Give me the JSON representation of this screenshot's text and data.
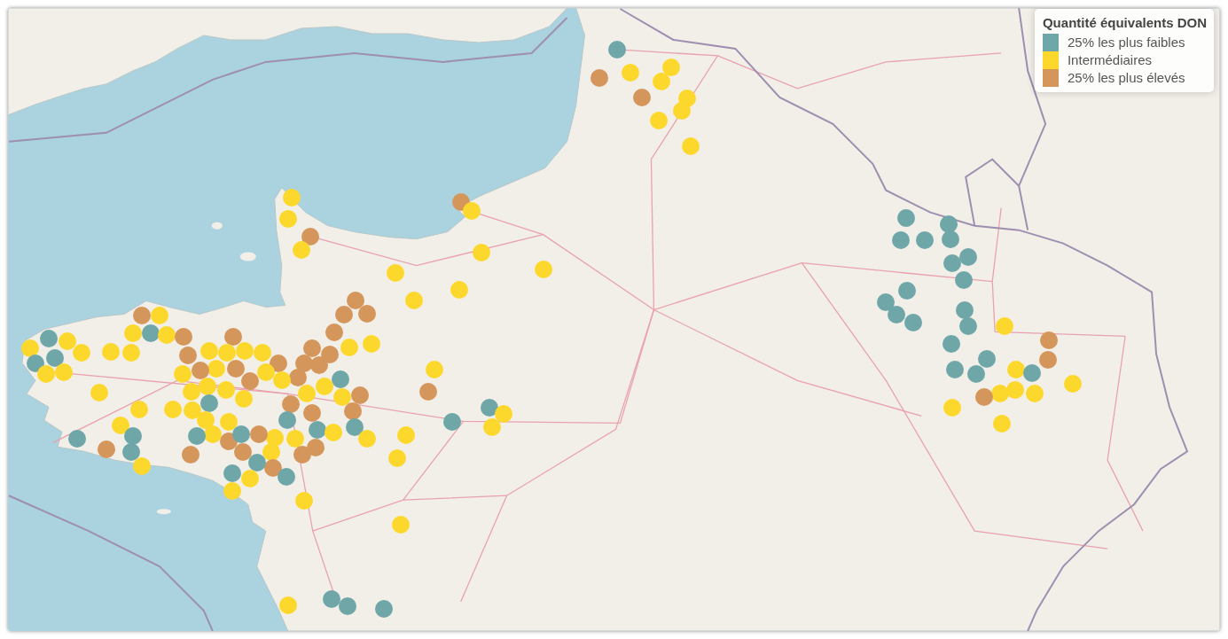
{
  "legend": {
    "title": "Quantité équivalents DON",
    "items": [
      {
        "label": "25% les plus faibles",
        "color": "#6fa7a9"
      },
      {
        "label": "Intermédiaires",
        "color": "#fdd82c"
      },
      {
        "label": "25% les plus élevés",
        "color": "#d4965b"
      }
    ]
  },
  "markers": [
    {
      "color": "#6fa7a9"
    },
    {
      "color": "#d4965b"
    },
    {
      "color": "#fdd82c"
    },
    {
      "color": "#fdd82c"
    },
    {
      "color": "#fdd82c"
    },
    {
      "color": "#d4965b"
    },
    {
      "color": "#fdd82c"
    },
    {
      "color": "#fdd82c"
    },
    {
      "color": "#fdd82c"
    },
    {
      "color": "#fdd82c"
    },
    {
      "color": "#fdd82c"
    },
    {
      "color": "#fdd82c"
    },
    {
      "color": "#d4965b"
    },
    {
      "color": "#fdd82c"
    },
    {
      "color": "#d4965b"
    },
    {
      "color": "#fdd82c"
    },
    {
      "color": "#fdd82c"
    },
    {
      "color": "#fdd82c"
    },
    {
      "color": "#fdd82c"
    },
    {
      "color": "#fdd82c"
    },
    {
      "color": "#fdd82c"
    },
    {
      "color": "#d4965b"
    },
    {
      "color": "#d4965b"
    },
    {
      "color": "#d4965b"
    },
    {
      "color": "#d4965b"
    },
    {
      "color": "#fdd82c"
    },
    {
      "color": "#fdd82c"
    },
    {
      "color": "#d4965b"
    },
    {
      "color": "#d4965b"
    },
    {
      "color": "#d4965b"
    },
    {
      "color": "#d4965b"
    },
    {
      "color": "#d4965b"
    },
    {
      "color": "#fdd82c"
    },
    {
      "color": "#d4965b"
    },
    {
      "color": "#6fa7a9"
    },
    {
      "color": "#fdd82c"
    },
    {
      "color": "#fdd82c"
    },
    {
      "color": "#d4965b"
    },
    {
      "color": "#d4965b"
    },
    {
      "color": "#fdd82c"
    },
    {
      "color": "#d4965b"
    },
    {
      "color": "#fdd82c"
    },
    {
      "color": "#d4965b"
    },
    {
      "color": "#6fa7a9"
    },
    {
      "color": "#6fa7a9"
    },
    {
      "color": "#fdd82c"
    },
    {
      "color": "#fdd82c"
    },
    {
      "color": "#6fa7a9"
    },
    {
      "color": "#6fa7a9"
    },
    {
      "color": "#d4965b"
    },
    {
      "color": "#6fa7a9"
    },
    {
      "color": "#fdd82c"
    },
    {
      "color": "#d4965b"
    },
    {
      "color": "#fdd82c"
    },
    {
      "color": "#fdd82c"
    },
    {
      "color": "#fdd82c"
    },
    {
      "color": "#fdd82c"
    },
    {
      "color": "#d4965b"
    },
    {
      "color": "#fdd82c"
    },
    {
      "color": "#fdd82c"
    },
    {
      "color": "#d4965b"
    },
    {
      "color": "#6fa7a9"
    },
    {
      "color": "#fdd82c"
    },
    {
      "color": "#fdd82c"
    },
    {
      "color": "#d4965b"
    },
    {
      "color": "#fdd82c"
    },
    {
      "color": "#fdd82c"
    },
    {
      "color": "#6fa7a9"
    },
    {
      "color": "#fdd82c"
    },
    {
      "color": "#d4965b"
    },
    {
      "color": "#fdd82c"
    },
    {
      "color": "#6fa7a9"
    },
    {
      "color": "#fdd82c"
    },
    {
      "color": "#fdd82c"
    },
    {
      "color": "#6fa7a9"
    },
    {
      "color": "#6fa7a9"
    },
    {
      "color": "#fdd82c"
    },
    {
      "color": "#fdd82c"
    },
    {
      "color": "#fdd82c"
    },
    {
      "color": "#d4965b"
    },
    {
      "color": "#fdd82c"
    },
    {
      "color": "#fdd82c"
    },
    {
      "color": "#d4965b"
    },
    {
      "color": "#fdd82c"
    },
    {
      "color": "#fdd82c"
    },
    {
      "color": "#d4965b"
    },
    {
      "color": "#fdd82c"
    },
    {
      "color": "#fdd82c"
    },
    {
      "color": "#d4965b"
    },
    {
      "color": "#fdd82c"
    },
    {
      "color": "#fdd82c"
    },
    {
      "color": "#6fa7a9"
    },
    {
      "color": "#fdd82c"
    },
    {
      "color": "#fdd82c"
    },
    {
      "color": "#d4965b"
    },
    {
      "color": "#fdd82c"
    },
    {
      "color": "#fdd82c"
    },
    {
      "color": "#fdd82c"
    },
    {
      "color": "#fdd82c"
    },
    {
      "color": "#fdd82c"
    },
    {
      "color": "#fdd82c"
    },
    {
      "color": "#fdd82c"
    },
    {
      "color": "#fdd82c"
    },
    {
      "color": "#d4965b"
    },
    {
      "color": "#6fa7a9"
    },
    {
      "color": "#fdd82c"
    },
    {
      "color": "#6fa7a9"
    },
    {
      "color": "#6fa7a9"
    },
    {
      "color": "#d4965b"
    },
    {
      "color": "#6fa7a9"
    },
    {
      "color": "#fdd82c"
    },
    {
      "color": "#d4965b"
    },
    {
      "color": "#6fa7a9"
    },
    {
      "color": "#d4965b"
    },
    {
      "color": "#6fa7a9"
    },
    {
      "color": "#d4965b"
    },
    {
      "color": "#6fa7a9"
    },
    {
      "color": "#fdd82c"
    },
    {
      "color": "#fdd82c"
    },
    {
      "color": "#6fa7a9"
    },
    {
      "color": "#6fa7a9"
    },
    {
      "color": "#fdd82c"
    },
    {
      "color": "#6fa7a9"
    },
    {
      "color": "#6fa7a9"
    },
    {
      "color": "#6fa7a9"
    },
    {
      "color": "#6fa7a9"
    },
    {
      "color": "#6fa7a9"
    },
    {
      "color": "#6fa7a9"
    },
    {
      "color": "#6fa7a9"
    },
    {
      "color": "#6fa7a9"
    },
    {
      "color": "#6fa7a9"
    },
    {
      "color": "#6fa7a9"
    },
    {
      "color": "#6fa7a9"
    },
    {
      "color": "#6fa7a9"
    },
    {
      "color": "#6fa7a9"
    },
    {
      "color": "#6fa7a9"
    },
    {
      "color": "#6fa7a9"
    },
    {
      "color": "#fdd82c"
    },
    {
      "color": "#6fa7a9"
    },
    {
      "color": "#d4965b"
    },
    {
      "color": "#d4965b"
    },
    {
      "color": "#6fa7a9"
    },
    {
      "color": "#6fa7a9"
    },
    {
      "color": "#6fa7a9"
    },
    {
      "color": "#fdd82c"
    },
    {
      "color": "#6fa7a9"
    },
    {
      "color": "#fdd82c"
    },
    {
      "color": "#fdd82c"
    },
    {
      "color": "#fdd82c"
    },
    {
      "color": "#d4965b"
    },
    {
      "color": "#fdd82c"
    },
    {
      "color": "#fdd82c"
    },
    {
      "color": "#fdd82c"
    },
    {
      "color": "#fdd82c"
    }
  ]
}
